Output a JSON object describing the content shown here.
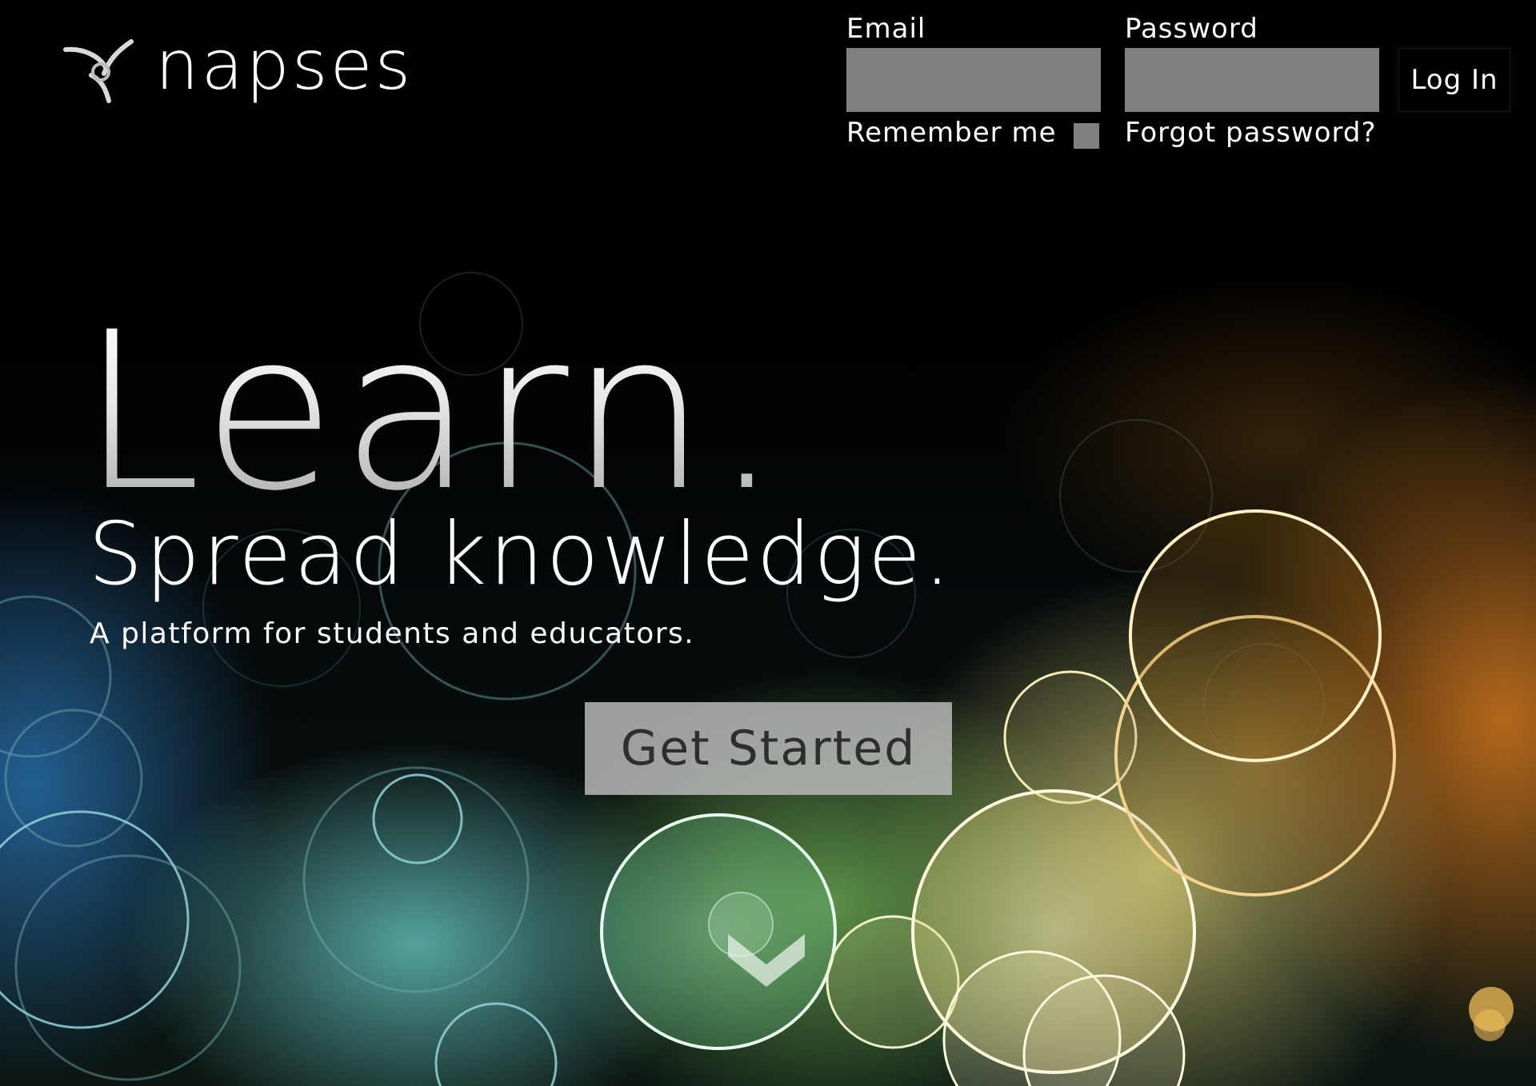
{
  "brand": {
    "name": "napses",
    "logo_icon": "napses-logo-icon"
  },
  "login": {
    "email_label": "Email",
    "email_value": "",
    "password_label": "Password",
    "password_value": "",
    "remember_label": "Remember me",
    "remember_checked": false,
    "forgot_label": "Forgot password?",
    "login_button": "Log In"
  },
  "hero": {
    "title": "Learn.",
    "subtitle": "Spread knowledge.",
    "tagline": "A platform for students and educators.",
    "cta_label": "Get Started",
    "scroll_icon": "chevron-down-icon"
  },
  "colors": {
    "background": "#000000",
    "input_fill": "#7f7f7f",
    "cta_fill": "#bebebe",
    "cta_text": "#2e2e2e",
    "text": "#ffffff"
  }
}
